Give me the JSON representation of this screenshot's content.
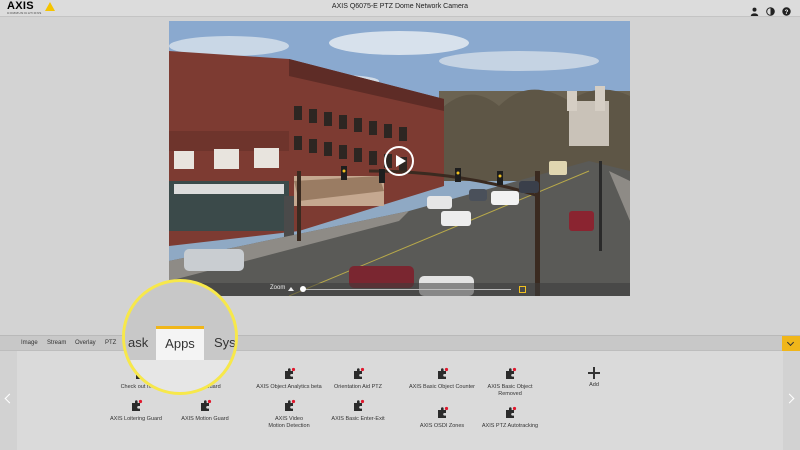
{
  "header": {
    "logo_text": "AXIS",
    "logo_sub": "COMMUNICATIONS",
    "title": "AXIS Q6075-E PTZ Dome Network Camera",
    "icons": [
      "user-icon",
      "contrast-icon",
      "help-icon"
    ]
  },
  "camera": {
    "zoom_label": "Zoom"
  },
  "tabs": [
    {
      "label": "Image"
    },
    {
      "label": "Stream"
    },
    {
      "label": "Overlay"
    },
    {
      "label": "PTZ"
    }
  ],
  "magnifier": {
    "left_tab": "ask",
    "active_tab": "Apps",
    "right_tab": "Syst"
  },
  "apps": [
    {
      "label": "Check out more"
    },
    {
      "label": "Guard"
    },
    {
      "label": "AXIS Object Analytics beta"
    },
    {
      "label": "Orientation Aid PTZ"
    },
    {
      "label": "AXIS Basic Object Counter"
    },
    {
      "label": "AXIS Basic Object Removed"
    },
    {
      "label": "Add"
    },
    {
      "label": "AXIS Loitering Guard"
    },
    {
      "label": "AXIS Motion Guard"
    },
    {
      "label": "AXIS Video Motion Detection"
    },
    {
      "label": "AXIS Basic Enter-Exit"
    },
    {
      "label": "AXIS OSDI Zones"
    },
    {
      "label": "AXIS PTZ Autotracking"
    }
  ],
  "colors": {
    "accent": "#f0b61a",
    "highlight_ring": "#f7e84a",
    "app_dot": "#e0182d"
  }
}
